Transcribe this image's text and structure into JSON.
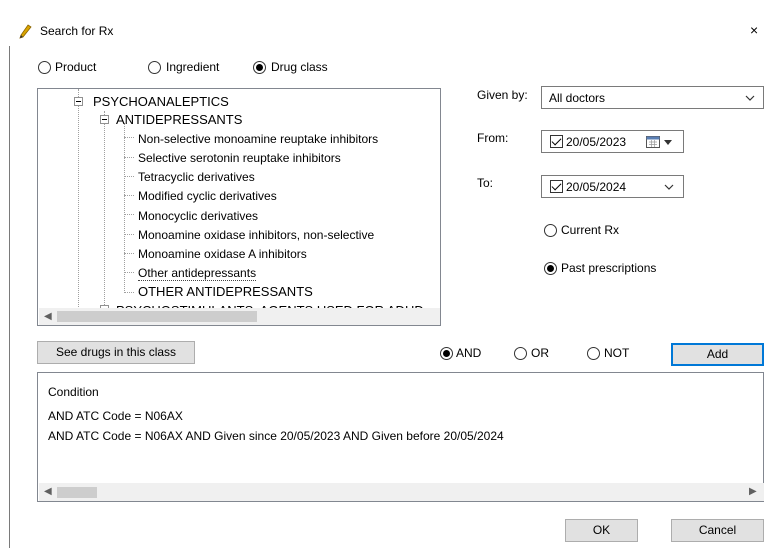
{
  "window": {
    "title": "Search for Rx",
    "close_glyph": "×"
  },
  "search_type": {
    "options": [
      "Product",
      "Ingredient",
      "Drug class"
    ],
    "selected": "Drug class"
  },
  "tree": {
    "rows": [
      {
        "label": "PSYCHOANALEPTICS",
        "level": 0,
        "expanded": true
      },
      {
        "label": "ANTIDEPRESSANTS",
        "level": 1,
        "expanded": true
      },
      {
        "label": "Non-selective monoamine reuptake inhibitors",
        "level": 2
      },
      {
        "label": "Selective serotonin reuptake inhibitors",
        "level": 2
      },
      {
        "label": "Tetracyclic derivatives",
        "level": 2
      },
      {
        "label": "Modified cyclic derivatives",
        "level": 2
      },
      {
        "label": "Monocyclic derivatives",
        "level": 2
      },
      {
        "label": "Monoamine oxidase inhibitors, non-selective",
        "level": 2
      },
      {
        "label": "Monoamine oxidase A inhibitors",
        "level": 2
      },
      {
        "label": "Other antidepressants",
        "level": 2,
        "selected": true
      },
      {
        "label": "OTHER ANTIDEPRESSANTS",
        "level": 2
      },
      {
        "label": "PSYCHOSTIMULANTS, AGENTS USED FOR ADHD",
        "level": 1,
        "expanded": true
      }
    ]
  },
  "see_drugs_button": "See drugs in this class",
  "given_by": {
    "label": "Given by:",
    "value": "All doctors"
  },
  "from": {
    "label": "From:",
    "value": "20/05/2023",
    "checked": true
  },
  "to": {
    "label": "To:",
    "value": "20/05/2024",
    "checked": true
  },
  "rx_scope": {
    "options": [
      "Current Rx",
      "Past prescriptions"
    ],
    "selected": "Past prescriptions"
  },
  "logic": {
    "options": [
      "AND",
      "OR",
      "NOT"
    ],
    "selected": "AND"
  },
  "add_button": "Add",
  "conditions": {
    "header": "Condition",
    "lines": [
      "AND ATC Code = N06AX",
      "AND ATC Code = N06AX AND Given since 20/05/2023 AND Given before 20/05/2024"
    ]
  },
  "ok_button": "OK",
  "cancel_button": "Cancel",
  "icons": {
    "app": "pen-icon",
    "calendar": "calendar-icon",
    "dropdown": "chevron-down-icon"
  },
  "colors": {
    "selection_border": "#0078d7",
    "button_face": "#e1e1e1",
    "scrollbar_track": "#f0f0f0"
  }
}
